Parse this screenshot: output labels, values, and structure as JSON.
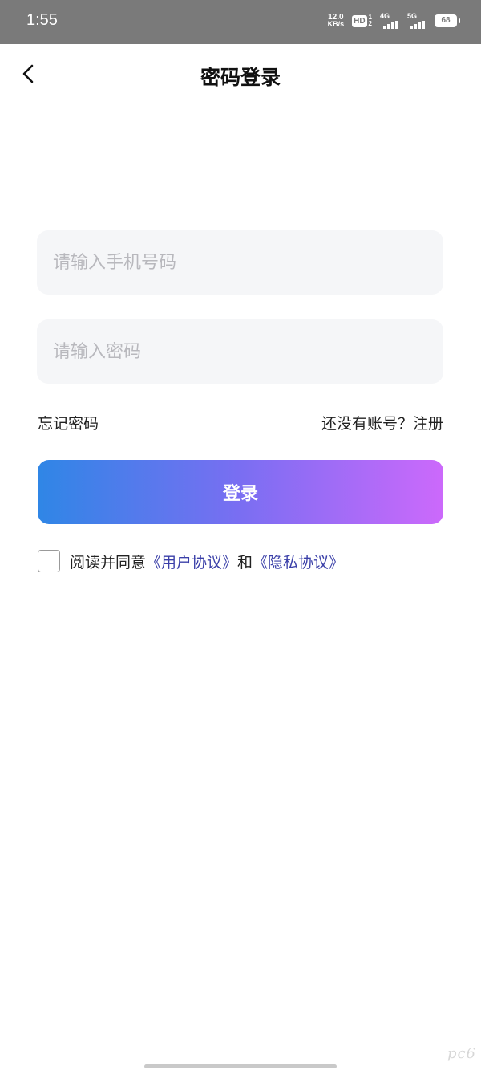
{
  "status_bar": {
    "time": "1:55",
    "net_speed_value": "12.0",
    "net_speed_unit": "KB/s",
    "hd_label": "HD",
    "hd_sub_top": "1",
    "hd_sub_bottom": "2",
    "signal1_label": "4G",
    "signal2_label": "5G",
    "battery": "68"
  },
  "header": {
    "title": "密码登录",
    "back_icon": "chevron-left-icon"
  },
  "form": {
    "phone_placeholder": "请输入手机号码",
    "password_placeholder": "请输入密码",
    "forgot_label": "忘记密码",
    "register_label": "还没有账号？注册",
    "login_label": "登录"
  },
  "agreement": {
    "prefix": "阅读并同意",
    "user_agreement": "《用户协议》",
    "and": "和",
    "privacy_policy": "《隐私协议》"
  },
  "watermark": "pc6",
  "colors": {
    "gradient_start": "#2f86e6",
    "gradient_end": "#cc69fb",
    "link": "#3a3fa8",
    "input_bg": "#f5f6f8"
  }
}
